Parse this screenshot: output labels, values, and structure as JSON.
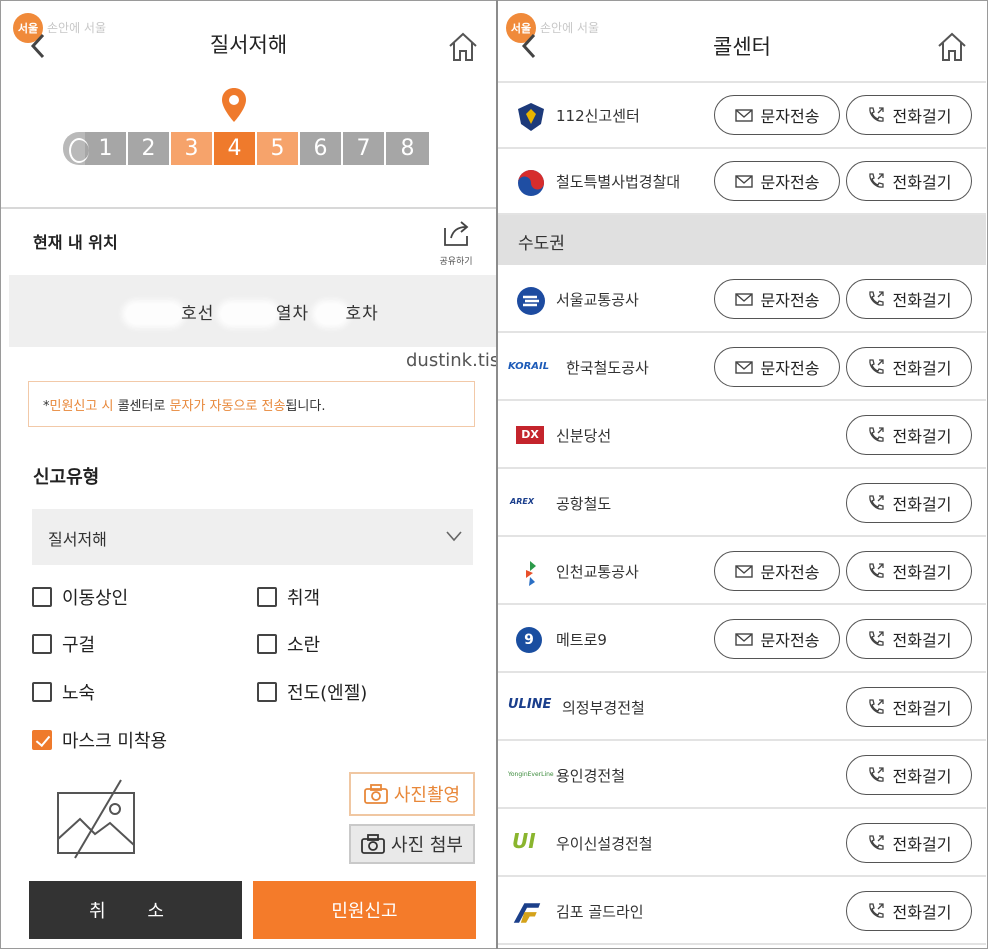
{
  "left_screen": {
    "logo_badge": "서울",
    "logo_faded": "손안에 서울",
    "title": "질서저해",
    "stepper": {
      "steps": [
        "1",
        "2",
        "3",
        "4",
        "5",
        "6",
        "7",
        "8"
      ],
      "active_step": 4
    },
    "location_label": "현재 내 위치",
    "share_label": "공유하기",
    "location_line": {
      "part1": "호선",
      "part2": "열차",
      "part3": "호차"
    },
    "watermark": "dustink.tistory.com",
    "notice": {
      "prefix": "*",
      "hl1": "민원신고 시",
      "mid": " 콜센터로 ",
      "hl2": "문자가 자동으로 전송",
      "suffix": "됩니다."
    },
    "report_type_label": "신고유형",
    "report_type_selected": "질서저해",
    "checkboxes": [
      {
        "label": "이동상인",
        "checked": false
      },
      {
        "label": "취객",
        "checked": false
      },
      {
        "label": "구걸",
        "checked": false
      },
      {
        "label": "소란",
        "checked": false
      },
      {
        "label": "노숙",
        "checked": false
      },
      {
        "label": "전도(엔젤)",
        "checked": false
      },
      {
        "label": "마스크 미착용",
        "checked": true
      }
    ],
    "photo_button": "사진촬영",
    "attach_button": "사진 첨부",
    "cancel_button": "취 소",
    "report_button": "민원신고",
    "accent_color": "#ef7a2c"
  },
  "right_screen": {
    "logo_badge": "서울",
    "logo_faded": "손안에 서울",
    "title": "콜센터",
    "sms_label": "문자전송",
    "call_label": "전화걸기",
    "region_label": "수도권",
    "top_rows": [
      {
        "name": "112신고센터",
        "logo": "police-badge-icon",
        "sms": true
      },
      {
        "name": "철도특별사법경찰대",
        "logo": "taegeuk-icon",
        "sms": true
      }
    ],
    "rows": [
      {
        "name": "서울교통공사",
        "logo": "seoul-metro-logo",
        "logo_text": "",
        "sms": true
      },
      {
        "name": "한국철도공사",
        "logo": "korail-logo",
        "logo_text": "KORAIL",
        "sms": true
      },
      {
        "name": "신분당선",
        "logo": "dx-logo",
        "logo_text": "DX",
        "sms": false
      },
      {
        "name": "공항철도",
        "logo": "arex-logo",
        "logo_text": "AREX",
        "sms": false
      },
      {
        "name": "인천교통공사",
        "logo": "incheon-logo",
        "logo_text": "",
        "sms": true
      },
      {
        "name": "메트로9",
        "logo": "metro9-logo",
        "logo_text": "9",
        "sms": true
      },
      {
        "name": "의정부경전철",
        "logo": "uline-logo",
        "logo_text": "ULINE",
        "sms": false
      },
      {
        "name": "용인경전철",
        "logo": "everline-logo",
        "logo_text": "YonginEverLine",
        "sms": false
      },
      {
        "name": "우이신설경전철",
        "logo": "ui-logo",
        "logo_text": "UI",
        "sms": false
      },
      {
        "name": "김포 골드라인",
        "logo": "goldline-logo",
        "logo_text": "",
        "sms": false
      }
    ]
  }
}
